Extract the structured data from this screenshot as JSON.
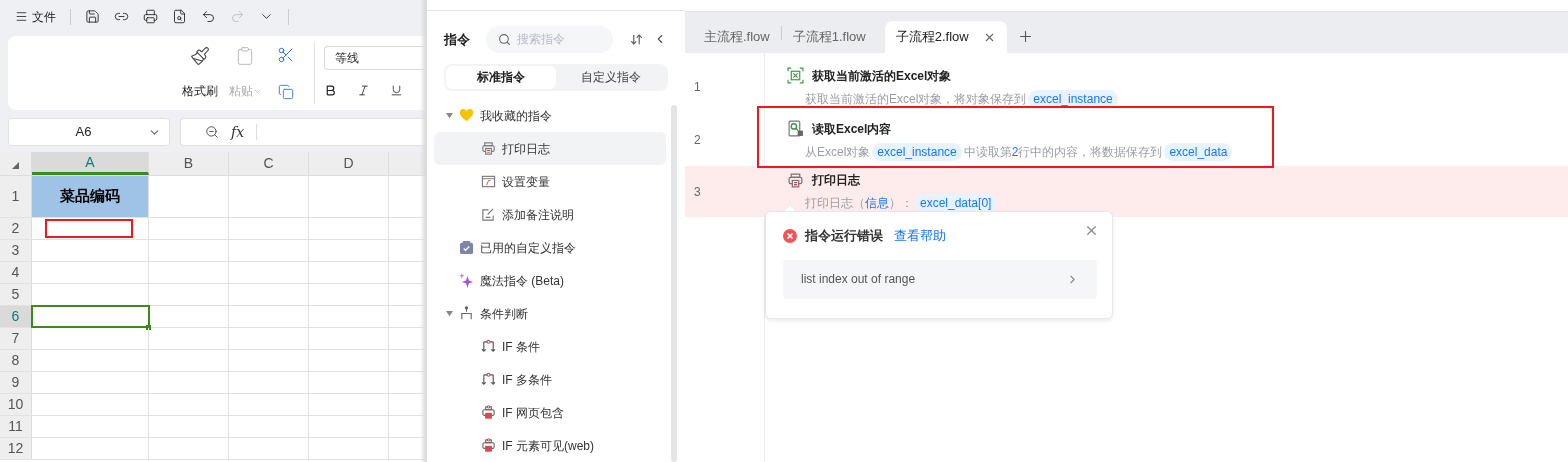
{
  "sheet": {
    "menu": {
      "label": "文件"
    },
    "redo": {
      "disabled": true
    },
    "ribbon": {
      "format_painter": "格式刷",
      "paste": {
        "label": "粘贴",
        "disabled": true
      },
      "font_name": "等线"
    },
    "name_box": "A6",
    "formula_label": "fx",
    "columns": [
      {
        "label": "A",
        "selected": true
      },
      {
        "label": "B",
        "selected": false
      },
      {
        "label": "C",
        "selected": false
      },
      {
        "label": "D",
        "selected": false
      }
    ],
    "rows": [
      {
        "label": "1",
        "selected": false,
        "highlighted": false,
        "a": "菜品编码"
      },
      {
        "label": "2",
        "selected": false,
        "highlighted": true
      },
      {
        "label": "3",
        "selected": false,
        "highlighted": false
      },
      {
        "label": "4",
        "selected": false,
        "highlighted": false
      },
      {
        "label": "5",
        "selected": false,
        "highlighted": false
      },
      {
        "label": "6",
        "selected": true,
        "highlighted": false
      },
      {
        "label": "7",
        "selected": false,
        "highlighted": false
      },
      {
        "label": "8",
        "selected": false,
        "highlighted": false
      },
      {
        "label": "9",
        "selected": false,
        "highlighted": false
      },
      {
        "label": "10",
        "selected": false,
        "highlighted": false
      },
      {
        "label": "11",
        "selected": false,
        "highlighted": false
      },
      {
        "label": "12",
        "selected": false,
        "highlighted": false
      }
    ]
  },
  "commands": {
    "title": "指令",
    "search": {
      "placeholder": "搜索指令"
    },
    "tabs": [
      {
        "label": "标准指令",
        "selected": true
      },
      {
        "label": "自定义指令",
        "selected": false
      }
    ],
    "tree": [
      {
        "label": "我收藏的指令",
        "kind": "favorites",
        "selected": false,
        "expanded": true,
        "children": [
          {
            "label": "打印日志",
            "kind": "print",
            "selected": true
          },
          {
            "label": "设置变量",
            "kind": "variable",
            "selected": false
          },
          {
            "label": "添加备注说明",
            "kind": "note",
            "selected": false
          }
        ]
      },
      {
        "label": "已用的自定义指令",
        "kind": "custom",
        "selected": false
      },
      {
        "label": "魔法指令 (Beta)",
        "kind": "magic",
        "selected": false
      },
      {
        "label": "条件判断",
        "kind": "condition",
        "selected": false,
        "expanded": true,
        "children": [
          {
            "label": "IF 条件",
            "kind": "if",
            "selected": false
          },
          {
            "label": "IF 多条件",
            "kind": "if",
            "selected": false
          },
          {
            "label": "IF 网页包含",
            "kind": "if-web",
            "selected": false
          },
          {
            "label": "IF 元素可见(web)",
            "kind": "if-web",
            "selected": false
          }
        ]
      }
    ]
  },
  "flow": {
    "tabs": [
      {
        "label": "主流程.flow",
        "selected": false
      },
      {
        "label": "子流程1.flow",
        "selected": false
      },
      {
        "label": "子流程2.flow",
        "selected": true
      }
    ],
    "steps": [
      {
        "number": "1",
        "kind": "excel-get",
        "title": "获取当前激活的Excel对象",
        "error": false,
        "highlighted": false,
        "description": [
          {
            "kind": "text",
            "text": "获取当前激活的Excel对象，将对象保存到"
          },
          {
            "kind": "var",
            "text": "excel_instance"
          }
        ]
      },
      {
        "number": "2",
        "kind": "excel-read",
        "title": "读取Excel内容",
        "error": false,
        "highlighted": true,
        "description": [
          {
            "kind": "text",
            "text": "从Excel对象"
          },
          {
            "kind": "var",
            "text": "excel_instance"
          },
          {
            "kind": "text",
            "text": "中读取第"
          },
          {
            "kind": "value",
            "text": "2"
          },
          {
            "kind": "text",
            "text": "行中的内容，将数据保存到"
          },
          {
            "kind": "var",
            "text": "excel_data"
          }
        ]
      },
      {
        "number": "3",
        "kind": "print",
        "title": "打印日志",
        "error": true,
        "highlighted": false,
        "description": [
          {
            "kind": "text",
            "text": "打印日志（"
          },
          {
            "kind": "value",
            "text": "信息"
          },
          {
            "kind": "text",
            "text": "）："
          },
          {
            "kind": "var",
            "text": "excel_data[0]"
          }
        ]
      }
    ],
    "error_popup": {
      "title": "指令运行错误",
      "help_link": "查看帮助",
      "message": "list index out of range"
    }
  }
}
